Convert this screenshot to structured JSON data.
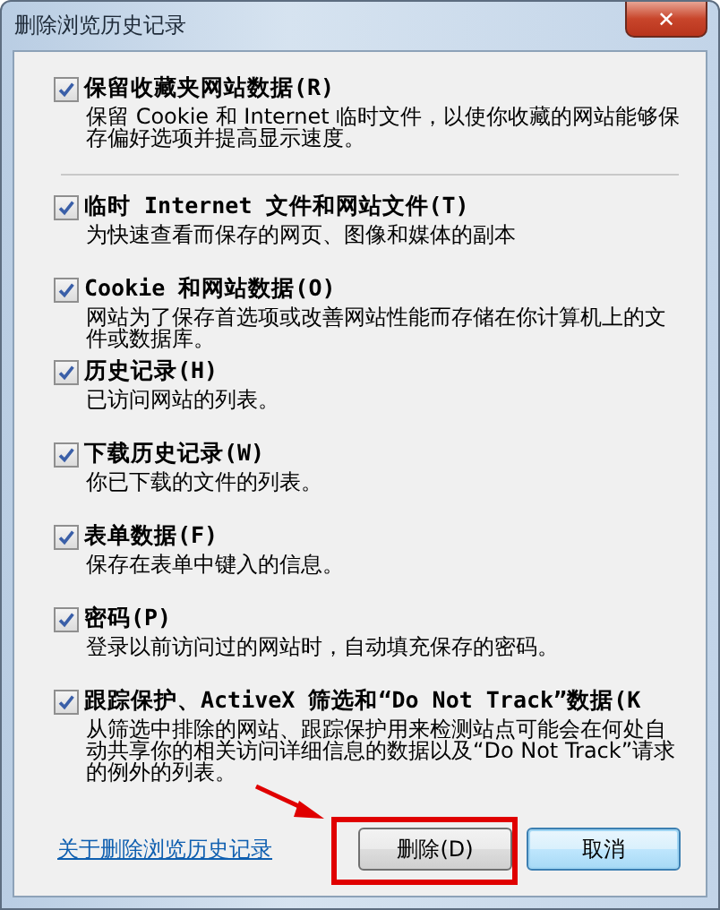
{
  "window": {
    "title": "删除浏览历史记录",
    "close_glyph": "✕"
  },
  "options": [
    {
      "label": "保留收藏夹网站数据(R)",
      "description": "保留 Cookie 和 Internet 临时文件，以使你收藏的网站能够保存偏好选项并提高显示速度。",
      "checked": true,
      "separator_after": true
    },
    {
      "label": "临时 Internet 文件和网站文件(T)",
      "description": "为快速查看而保存的网页、图像和媒体的副本",
      "checked": true,
      "separator_after": false
    },
    {
      "label": "Cookie 和网站数据(O)",
      "description": "网站为了保存首选项或改善网站性能而存储在你计算机上的文件或数据库。",
      "checked": true,
      "separator_after": false
    },
    {
      "label": "历史记录(H)",
      "description": "已访问网站的列表。",
      "checked": true,
      "separator_after": false
    },
    {
      "label": "下载历史记录(W)",
      "description": "你已下载的文件的列表。",
      "checked": true,
      "separator_after": false
    },
    {
      "label": "表单数据(F)",
      "description": "保存在表单中键入的信息。",
      "checked": true,
      "separator_after": false
    },
    {
      "label": "密码(P)",
      "description": "登录以前访问过的网站时，自动填充保存的密码。",
      "checked": true,
      "separator_after": false
    },
    {
      "label": "跟踪保护、ActiveX 筛选和“Do Not Track”数据(K",
      "description": "从筛选中排除的网站、跟踪保护用来检测站点可能会在何处自动共享你的相关访问详细信息的数据以及“Do Not Track”请求的例外的列表。",
      "checked": true,
      "separator_after": false
    }
  ],
  "footer": {
    "link": "关于删除浏览历史记录",
    "buttons": [
      {
        "label": "删除(D)",
        "kind": "default"
      },
      {
        "label": "取消",
        "kind": "focused"
      }
    ]
  },
  "annotations": {
    "arrow": true,
    "highlight_box": true
  }
}
